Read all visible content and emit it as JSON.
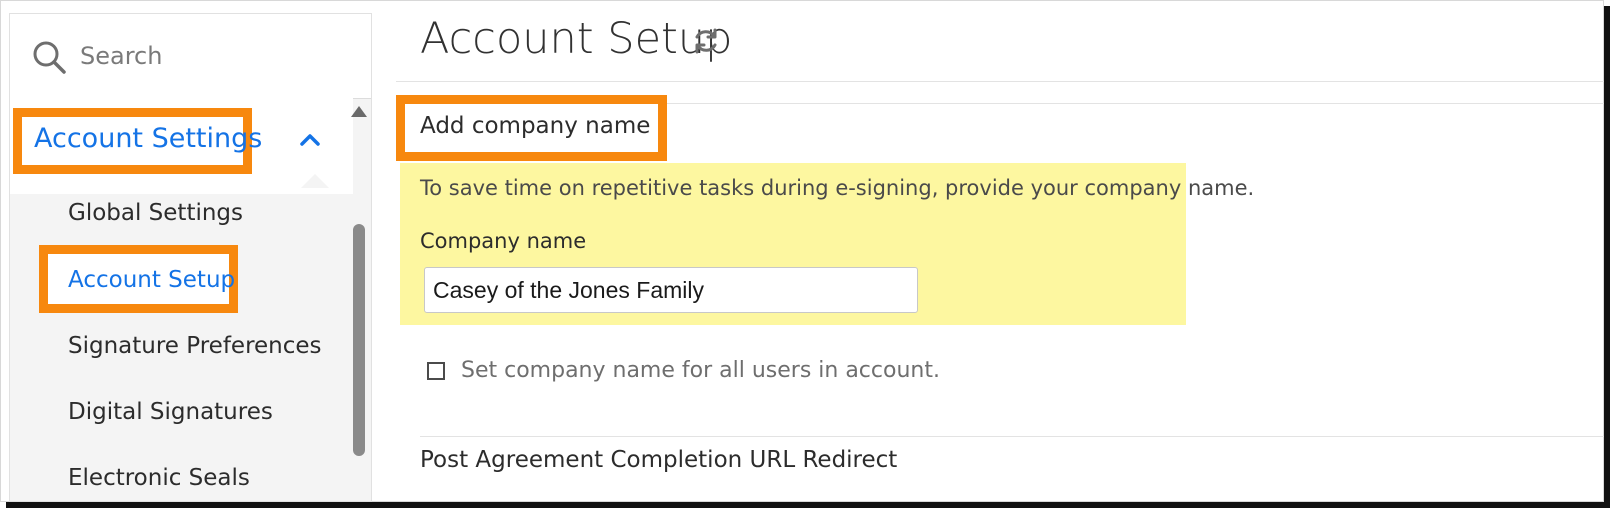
{
  "sidebar": {
    "search_placeholder": "Search",
    "group_label": "Account Settings",
    "items": [
      {
        "label": "Global Settings"
      },
      {
        "label": "Account Setup"
      },
      {
        "label": "Signature Preferences"
      },
      {
        "label": "Digital Signatures"
      },
      {
        "label": "Electronic Seals"
      }
    ],
    "active_item": "Account Setup"
  },
  "main": {
    "page_title": "Account Setup",
    "section": {
      "title": "Add company name",
      "help_text": "To save time on repetitive tasks during e-signing, provide your company name.",
      "field_label": "Company name",
      "field_value": "Casey of the Jones Family",
      "checkbox_label": "Set company name for all users in account.",
      "checkbox_checked": false
    },
    "next_section_title": "Post Agreement Completion URL Redirect"
  },
  "colors": {
    "accent_blue": "#1473e6",
    "highlight_orange": "#f7880e",
    "panel_yellow": "#fdf7a0"
  },
  "icons": {
    "search": "search-icon",
    "collapse": "chevron-up-icon",
    "refresh": "refresh-icon"
  }
}
